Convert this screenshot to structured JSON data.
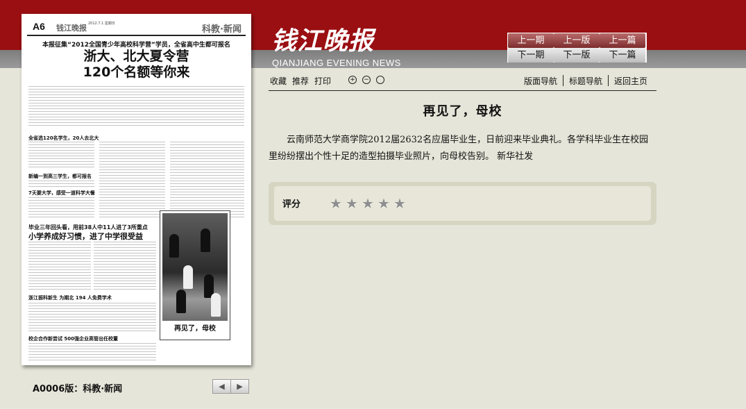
{
  "newspaper": {
    "page_no": "A6",
    "masthead_small": "钱江晚报",
    "date": "2012.7.1 星期日",
    "section": "科教·新闻",
    "kicker": "本报征集“2012全国青少年高校科学营”学员，全省高中生都可报名",
    "headline_1": "浙大、北大夏令营",
    "headline_2": "120个名额等你来",
    "sub_1": "全省选120名学生，20人去北大",
    "sub_2": "新编一到高三学生，都可报名",
    "sub_3": "7天要大学，感受一道科学大餐",
    "story2_kicker": "毕业三年回头看，用前38人中11人进了3所重点",
    "story2_head": "小学养成好习惯，进了中学很受益",
    "sub_4": "浙江振科新生  为期北 194 人免费学术",
    "sub_5": "校企合作新尝试 500强企业高管出任校董",
    "photo_caption": "再见了，母校"
  },
  "masthead": {
    "title": "钱江晚报",
    "subtitle": "QIANJIANG EVENING NEWS"
  },
  "nav": {
    "prev_issue": "上一期",
    "prev_page": "上一版",
    "prev_article": "上一篇",
    "next_issue": "下一期",
    "next_page": "下一版",
    "next_article": "下一篇"
  },
  "toolbar": {
    "favorite": "收藏",
    "recommend": "推荐",
    "print": "打印",
    "zoom_in": "+",
    "zoom_out": "−",
    "reset": "",
    "layout_nav": "版面导航",
    "title_nav": "标题导航",
    "home": "返回主页"
  },
  "article": {
    "title": "再见了，母校",
    "body": "云南师范大学商学院2012届2632名应届毕业生，日前迎来毕业典礼。各学科毕业生在校园里纷纷摆出个性十足的造型拍摄毕业照片，向母校告别。    新华社发"
  },
  "rating": {
    "label": "评分",
    "stars_total": 5
  },
  "footer": {
    "page_label": "A0006版：科教·新闻",
    "prev": "◀",
    "next": "▶"
  },
  "colors": {
    "brand_red": "#9a0f12",
    "background": "#e6e5d9"
  }
}
